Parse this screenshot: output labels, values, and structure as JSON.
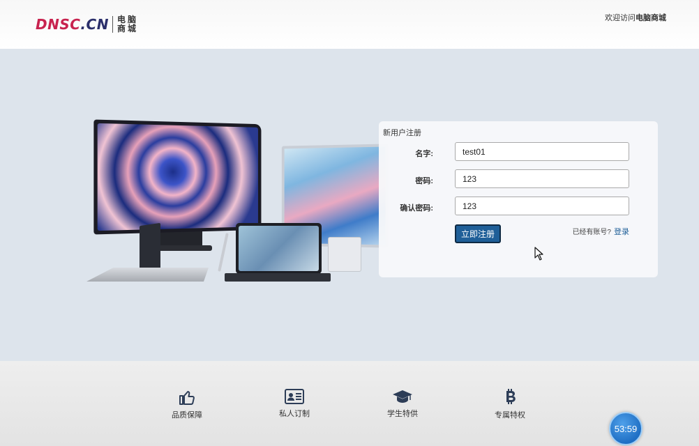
{
  "header": {
    "logo_text_a": "DNSC",
    "logo_text_b": ".CN",
    "logo_cn": "电脑商城",
    "welcome_prefix": "欢迎访问",
    "welcome_brand": "电脑商城"
  },
  "form": {
    "title": "新用户注册",
    "name_label": "名字:",
    "name_value": "test01",
    "password_label": "密码:",
    "password_value": "123",
    "confirm_label": "确认密码:",
    "confirm_value": "123",
    "submit_label": "立即注册",
    "login_prompt": "已经有账号?",
    "login_link": "登录"
  },
  "features": [
    {
      "label": "品质保障",
      "icon": "thumbs-up-icon"
    },
    {
      "label": "私人订制",
      "icon": "id-card-icon"
    },
    {
      "label": "学生特供",
      "icon": "graduation-cap-icon"
    },
    {
      "label": "专属特权",
      "icon": "bitcoin-icon"
    }
  ],
  "timer": "53:59",
  "colors": {
    "brand_red": "#c8234f",
    "brand_navy": "#2b2f6b",
    "button_blue": "#1f5f98",
    "icon_navy": "#2d3d57"
  }
}
